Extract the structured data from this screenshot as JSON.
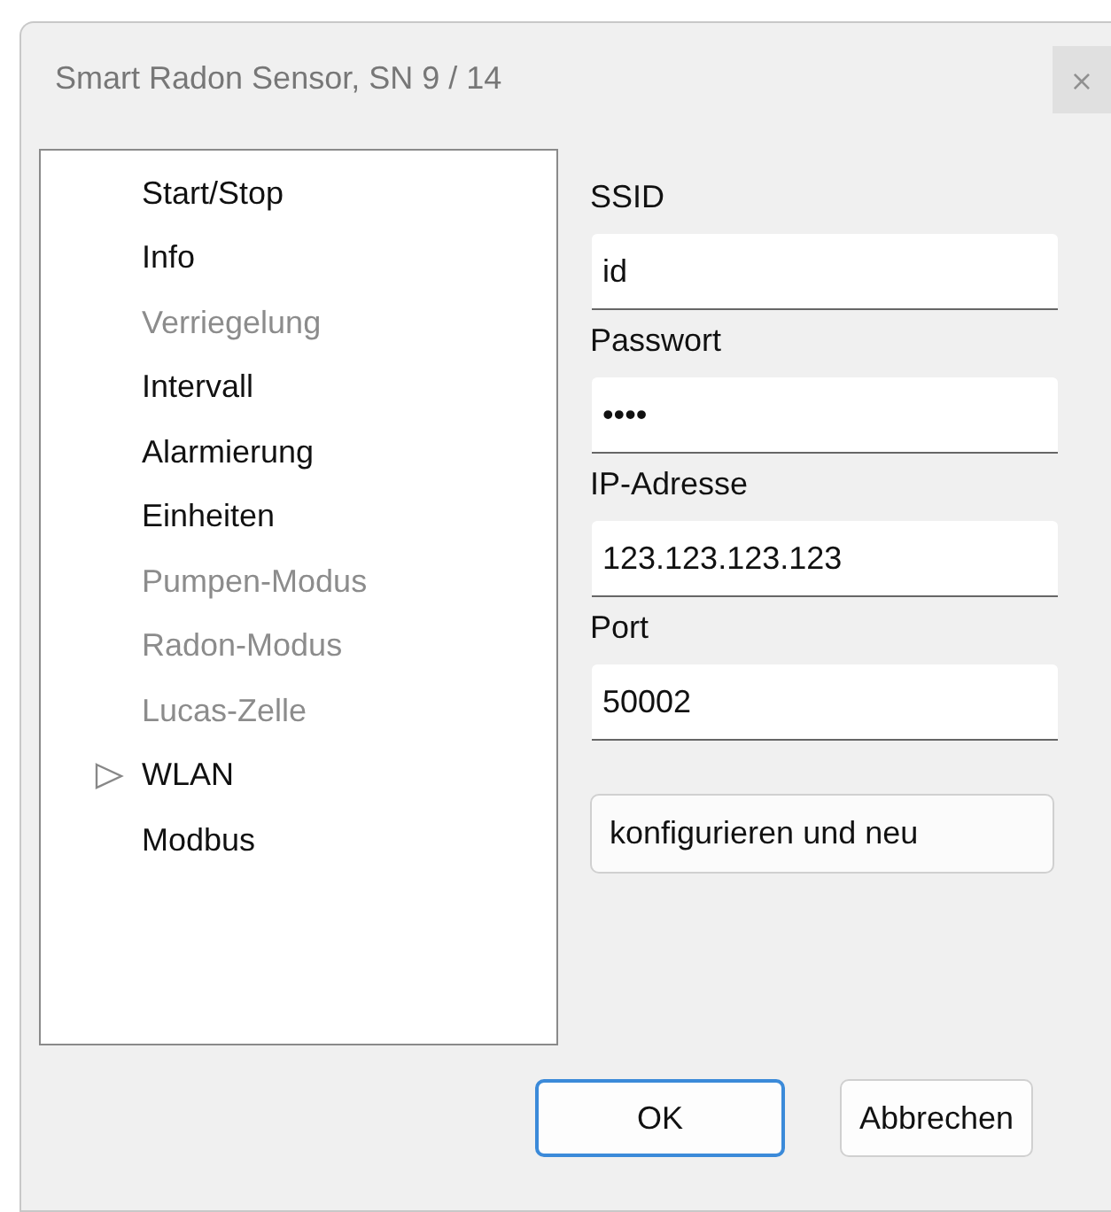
{
  "window": {
    "title": "Smart Radon Sensor, SN 9 / 14",
    "close": "×"
  },
  "sidebar": {
    "items": [
      {
        "label": "Start/Stop",
        "disabled": false,
        "selected": false
      },
      {
        "label": "Info",
        "disabled": false,
        "selected": false
      },
      {
        "label": "Verriegelung",
        "disabled": true,
        "selected": false
      },
      {
        "label": "Intervall",
        "disabled": false,
        "selected": false
      },
      {
        "label": "Alarmierung",
        "disabled": false,
        "selected": false
      },
      {
        "label": "Einheiten",
        "disabled": false,
        "selected": false
      },
      {
        "label": "Pumpen-Modus",
        "disabled": true,
        "selected": false
      },
      {
        "label": "Radon-Modus",
        "disabled": true,
        "selected": false
      },
      {
        "label": "Lucas-Zelle",
        "disabled": true,
        "selected": false
      },
      {
        "label": "WLAN",
        "disabled": false,
        "selected": true
      },
      {
        "label": "Modbus",
        "disabled": false,
        "selected": false
      }
    ]
  },
  "fields": [
    {
      "label": "SSID",
      "value": "id"
    },
    {
      "label": "Passwort",
      "value": "••••"
    },
    {
      "label": "IP-Adresse",
      "value": "123.123.123.123"
    },
    {
      "label": "Port",
      "value": "50002"
    }
  ],
  "action_button": "konfigurieren und neu",
  "buttons": [
    {
      "label": "OK",
      "default": true
    },
    {
      "label": "Abbrechen",
      "default": false
    }
  ]
}
